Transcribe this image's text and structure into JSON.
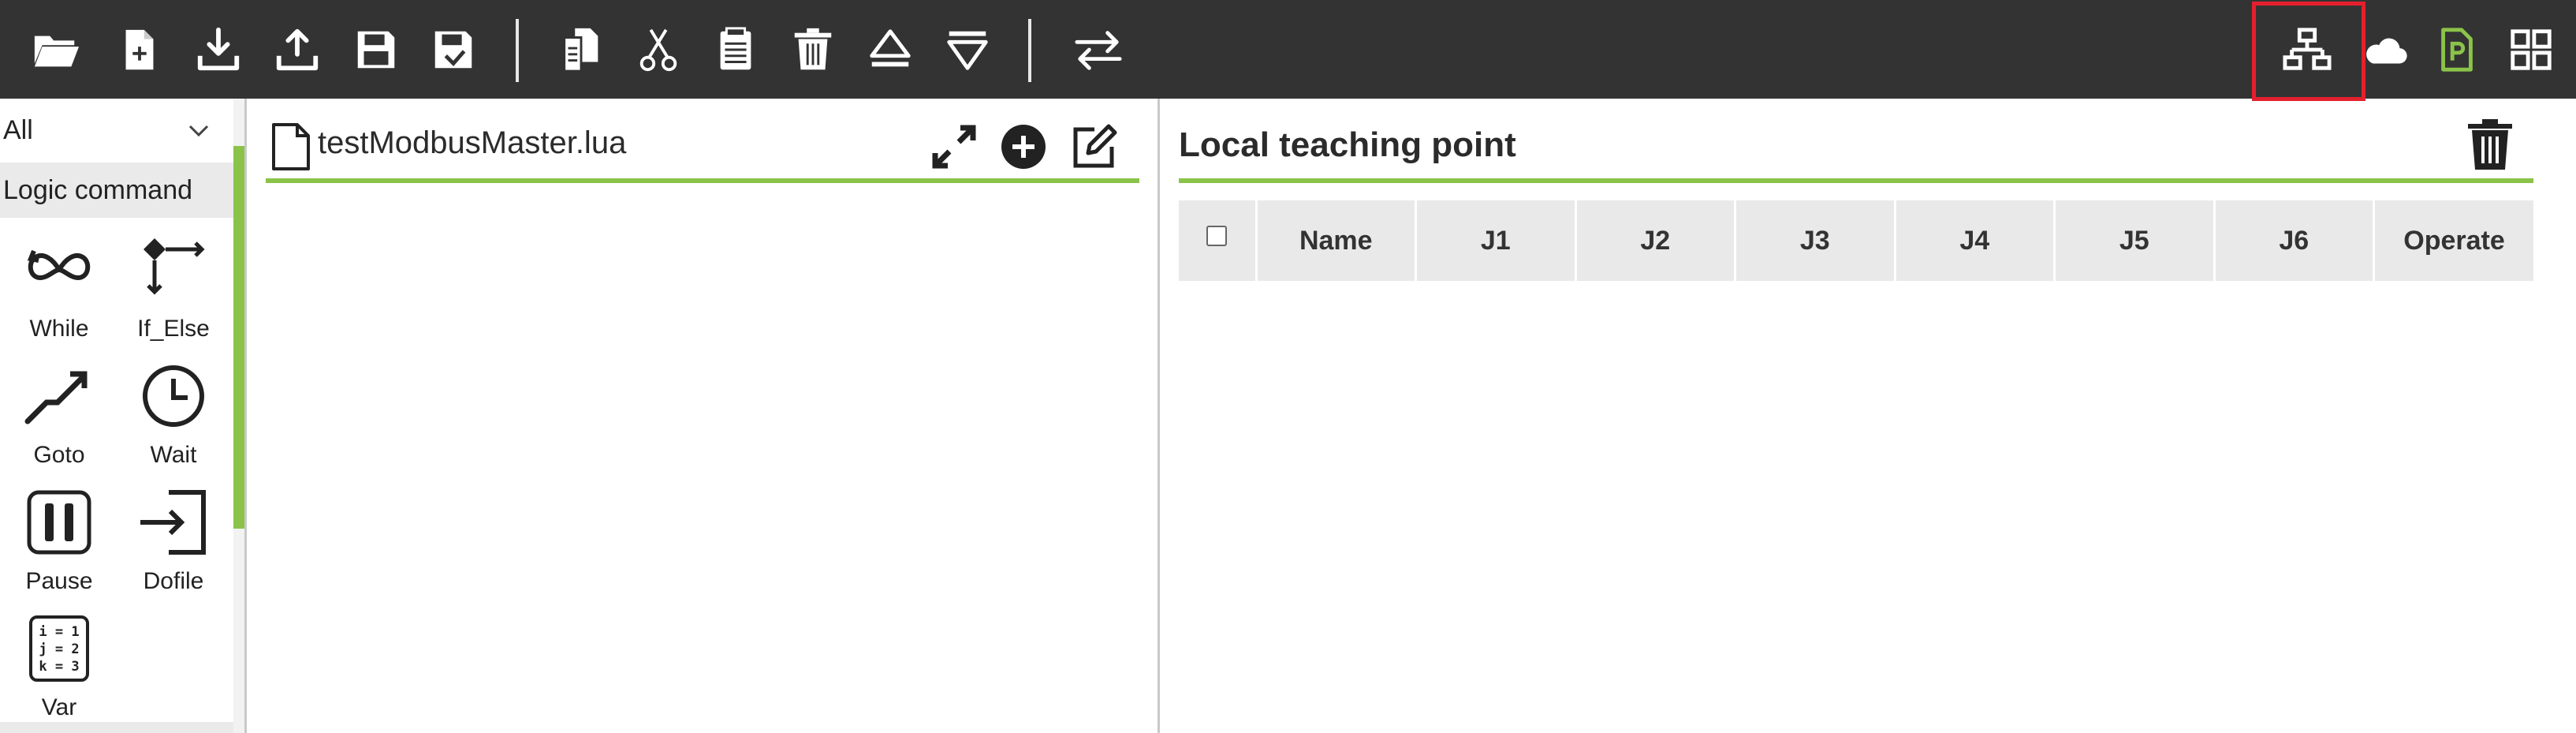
{
  "toolbar": {
    "left_icons": [
      "open-folder-icon",
      "new-file-icon",
      "download-icon",
      "upload-icon",
      "save-icon",
      "save-as-icon",
      "copy-icon",
      "cut-icon",
      "paste-icon",
      "delete-icon",
      "eject-icon",
      "drop-icon",
      "swap-arrows-icon"
    ],
    "right_icons": [
      "network-icon",
      "cloud-icon",
      "plc-file-icon",
      "grid-apps-icon"
    ],
    "plc_icon_color": "#8bc34a",
    "highlight_color": "#e5202e"
  },
  "command_panel": {
    "filter_value": "All",
    "category_label": "Logic command",
    "items": [
      {
        "label": "While",
        "icon": "while-loop-icon"
      },
      {
        "label": "If_Else",
        "icon": "if-else-icon"
      },
      {
        "label": "Goto",
        "icon": "goto-icon"
      },
      {
        "label": "Wait",
        "icon": "clock-icon"
      },
      {
        "label": "Pause",
        "icon": "pause-icon"
      },
      {
        "label": "Dofile",
        "icon": "dofile-icon"
      },
      {
        "label": "Var",
        "icon": "variable-icon"
      }
    ],
    "var_icon_lines": [
      "i = 1",
      "j = 2",
      "k = 3"
    ],
    "accent_color": "#8bc34a"
  },
  "editor": {
    "file_name": "testModbusMaster.lua"
  },
  "teaching_points": {
    "title": "Local teaching point",
    "columns": [
      "Name",
      "J1",
      "J2",
      "J3",
      "J4",
      "J5",
      "J6",
      "Operate"
    ],
    "rows": []
  }
}
